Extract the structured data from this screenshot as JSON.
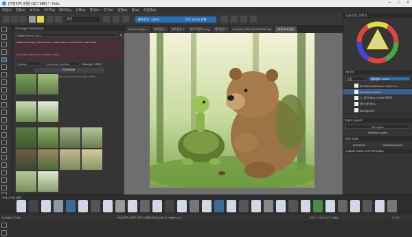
{
  "window": {
    "title": "[저장되지 않음] (12.7 MiB) * - Krita"
  },
  "menu": [
    "파일(F)",
    "편집(E)",
    "보기(V)",
    "이미지(I)",
    "레이어(L)",
    "선택(S)",
    "필터(R)",
    "도구(T)",
    "설정(N)",
    "창(W)",
    "도움말(H)"
  ],
  "toolbar": {
    "blend_mode": "일반",
    "opacity": "불투명도: 100%",
    "size": "크기: 40.00 픽셀"
  },
  "left_panel": {
    "title": "AI Image Generation",
    "model": "Digital Artwork (XL)",
    "prompt": "Watercolor style a bear and a turtle talk in a secret lot in the forest",
    "negative_prompt": "Describe content you want to avoid.",
    "control": "Scribble",
    "control_mode": "(Custom) Scribble",
    "strength": "Strength: 100%",
    "generate_button": "Generate",
    "history_label": "Watercolor style a bear and a turtle talk in a secret lot in the forest"
  },
  "tabs": [
    "ancient sculptu...",
    "제목없음 2",
    "제목없음 3",
    "게이트웨이2.png",
    "제목없음 3",
    "tradefair_2024-0814-01MB.bpet",
    "[저장되지 않음]"
  ],
  "right_panel": {
    "color_header": "고급 색상 선택기",
    "layers_header": "레이어",
    "blend": "일반",
    "opacity": "불투명도: 100%",
    "layers": [
      {
        "name": "[Preview] Watercolor Style A b...",
        "selected": false
      },
      {
        "name": "[Control] Scribble",
        "selected": true
      },
      {
        "name": "ㅊ_원키 Bear Grand 레이어",
        "selected": false
      },
      {
        "name": "필터 레이어 1",
        "selected": false
      },
      {
        "name": "Background",
        "selected": false
      }
    ],
    "inputs_label": "Input Layers",
    "inputs_value": "All Layers",
    "selected_layers": "Selected Layers",
    "edit_label": "Edit Tools",
    "document": "Document",
    "selected_layers2": "Selected Layers",
    "update_label": "Update Name and Template"
  },
  "brushbar": {
    "label": "브러시 미리 설정"
  },
  "status": {
    "left": "b) Basic-5 Size",
    "mid": "RGB/알파 (8비트 정수) /채널 sRGB-elle-V2-srgbtrc.icc",
    "right": "1024 × 1024 (12.7 MiB)",
    "zoom": "77.3%"
  },
  "colors": {
    "accent": "#2a6fb5",
    "prompt_bg": "#4a2e36"
  }
}
